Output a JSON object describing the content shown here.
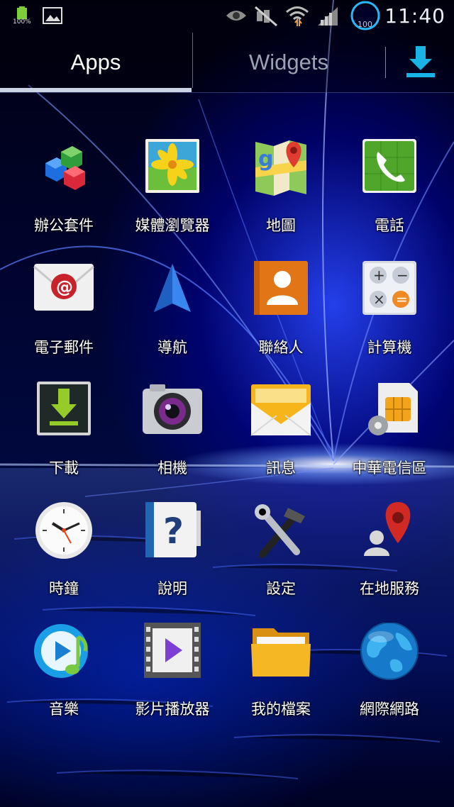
{
  "status_bar": {
    "battery_level": "100%",
    "signal_circle_value": "100",
    "time": "11:40",
    "icons": [
      "battery-icon",
      "gallery-icon",
      "eye-icon",
      "mute-icon",
      "wifi-icon",
      "cell-signal-icon",
      "circle-gauge-icon"
    ]
  },
  "tabs": {
    "apps": "Apps",
    "widgets": "Widgets",
    "download_icon": "download-icon"
  },
  "apps": [
    {
      "label": "辦公套件",
      "icon": "office-suite-icon"
    },
    {
      "label": "媒體瀏覽器",
      "icon": "media-browser-icon"
    },
    {
      "label": "地圖",
      "icon": "maps-icon"
    },
    {
      "label": "電話",
      "icon": "phone-icon"
    },
    {
      "label": "電子郵件",
      "icon": "email-icon"
    },
    {
      "label": "導航",
      "icon": "navigation-icon"
    },
    {
      "label": "聯絡人",
      "icon": "contacts-icon"
    },
    {
      "label": "計算機",
      "icon": "calculator-icon"
    },
    {
      "label": "下載",
      "icon": "downloads-icon"
    },
    {
      "label": "相機",
      "icon": "camera-icon"
    },
    {
      "label": "訊息",
      "icon": "messages-icon"
    },
    {
      "label": "中華電信區",
      "icon": "sim-toolkit-icon"
    },
    {
      "label": "時鐘",
      "icon": "clock-icon"
    },
    {
      "label": "說明",
      "icon": "help-icon"
    },
    {
      "label": "設定",
      "icon": "settings-icon"
    },
    {
      "label": "在地服務",
      "icon": "local-services-icon"
    },
    {
      "label": "音樂",
      "icon": "music-icon"
    },
    {
      "label": "影片播放器",
      "icon": "video-player-icon"
    },
    {
      "label": "我的檔案",
      "icon": "my-files-icon"
    },
    {
      "label": "網際網路",
      "icon": "internet-icon"
    }
  ],
  "colors": {
    "tab_underline": "#c9d3e3",
    "download_accent": "#19b3e6",
    "background_glow": "#2846ff"
  }
}
